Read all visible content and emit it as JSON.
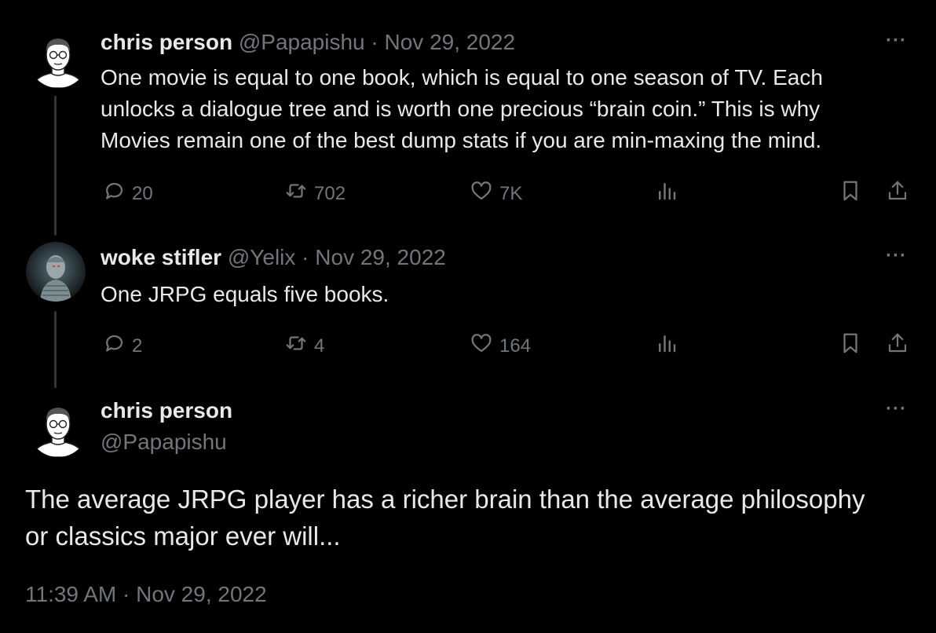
{
  "tweets": [
    {
      "name": "chris person",
      "handle": "@Papapishu",
      "separator": "·",
      "date": "Nov 29, 2022",
      "lines": [
        "One movie is equal to one book, which is equal to one season of TV. Each",
        "unlocks a dialogue tree and is worth one precious “brain coin.” This is why",
        "Movies remain one of the best dump stats if you are min-maxing the mind."
      ],
      "replies": "20",
      "retweets": "702",
      "likes": "7K"
    },
    {
      "name": "woke stifler",
      "handle": "@Yelix",
      "separator": "·",
      "date": "Nov 29, 2022",
      "lines": [
        "One JRPG equals five books."
      ],
      "replies": "2",
      "retweets": "4",
      "likes": "164"
    }
  ],
  "focal": {
    "name": "chris person",
    "handle": "@Papapishu",
    "lines": [
      "The average JRPG player has a richer brain than the average philosophy",
      "or classics major ever will..."
    ],
    "timestamp": "11:39 AM · Nov 29, 2022"
  },
  "more_label": "···",
  "icons": {
    "reply": "reply-icon",
    "retweet": "retweet-icon",
    "like": "heart-icon",
    "views": "views-icon",
    "bookmark": "bookmark-icon",
    "share": "share-icon"
  }
}
